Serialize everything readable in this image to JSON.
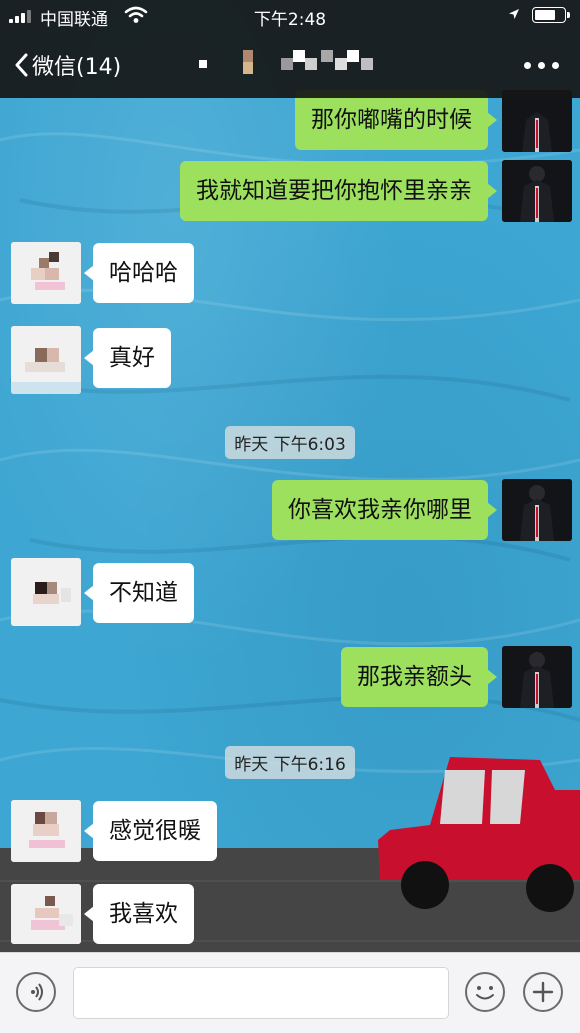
{
  "status_bar": {
    "carrier": "中国联通",
    "time": "下午2:48",
    "battery_level_percent": 75
  },
  "nav": {
    "back_label": "微信(14)",
    "title": "",
    "more_icon": "ellipsis-icon"
  },
  "messages": [
    {
      "side": "me",
      "text": "那你嘟嘴的时候"
    },
    {
      "side": "me",
      "text": "我就知道要把你抱怀里亲亲"
    },
    {
      "side": "other",
      "text": "哈哈哈"
    },
    {
      "side": "other",
      "text": "真好"
    },
    {
      "type": "time",
      "text": "昨天 下午6:03"
    },
    {
      "side": "me",
      "text": "你喜欢我亲你哪里"
    },
    {
      "side": "other",
      "text": "不知道"
    },
    {
      "side": "me",
      "text": "那我亲额头"
    },
    {
      "type": "time",
      "text": "昨天 下午6:16"
    },
    {
      "side": "other",
      "text": "感觉很暖"
    },
    {
      "side": "other",
      "text": "我喜欢"
    }
  ],
  "input_bar": {
    "voice_icon": "voice-icon",
    "input_value": "",
    "emoji_icon": "emoji-icon",
    "plus_icon": "plus-icon"
  },
  "colors": {
    "my_bubble": "#9de05e",
    "other_bubble": "#ffffff",
    "wallpaper": "#3da6d2"
  }
}
